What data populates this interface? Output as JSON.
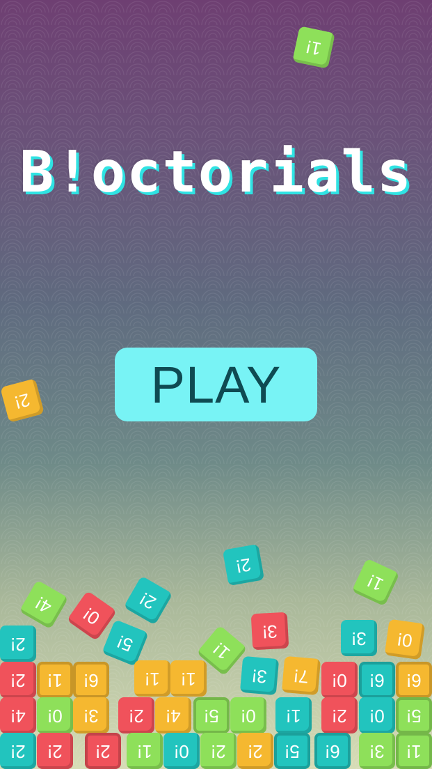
{
  "title": "B!octorials",
  "play_label": "PLAY",
  "colors": {
    "red": "#f0525b",
    "green": "#8ee05a",
    "teal": "#22c4be",
    "orange": "#f5b830",
    "button": "#78f3f5"
  },
  "tiles": {
    "t1": "1!",
    "t2": "2!",
    "t3": "2!",
    "t4": "1!",
    "t5": "0!",
    "t6": "2!",
    "t7": "5!",
    "t8": "4!",
    "t9": "1!",
    "t10": "3!",
    "t11": "0!",
    "t12": "2!",
    "t13": "2!",
    "t14": "1!",
    "t15": "6!",
    "t16": "1!",
    "t17": "1!",
    "t18": "3!",
    "t19": "1!",
    "t20": "0!",
    "t21": "6!",
    "t22": "6!",
    "t23": "4!",
    "t24": "0!",
    "t25": "3!",
    "t26": "2!",
    "t27": "4!",
    "t28": "5!",
    "t29": "0!",
    "t30": "1!",
    "t31": "2!",
    "t32": "0!",
    "t33": "5!",
    "t34": "2!",
    "t35": "2!",
    "t36": "2!",
    "t37": "1!",
    "t38": "0!",
    "t39": "2!",
    "t40": "2!",
    "t41": "5!",
    "t42": "6!",
    "t43": "3!",
    "t44": "1!",
    "t45": "3!",
    "t46": "7!"
  }
}
